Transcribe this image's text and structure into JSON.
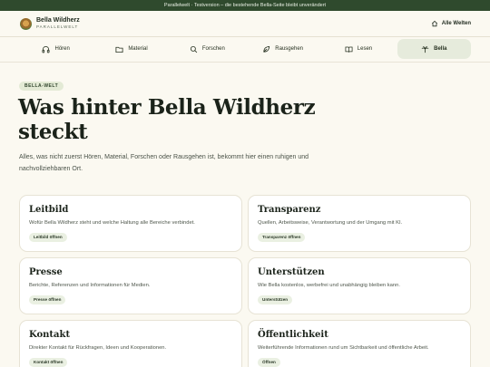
{
  "banner": {
    "text": "Parallelwelt · Testversion – die bestehende Bella-Seite bleibt unverändert"
  },
  "brand": {
    "name": "Bella Wildherz",
    "subtitle": "PARALLELWELT",
    "logo_icon": "bella-logo"
  },
  "header": {
    "worlds_label": "Alle Welten",
    "worlds_icon": "home-icon"
  },
  "nav": {
    "items": [
      {
        "label": "Hören",
        "icon": "headphones-icon",
        "active": false
      },
      {
        "label": "Material",
        "icon": "folder-icon",
        "active": false
      },
      {
        "label": "Forschen",
        "icon": "search-icon",
        "active": false
      },
      {
        "label": "Rausgehen",
        "icon": "leaf-icon",
        "active": false
      },
      {
        "label": "Lesen",
        "icon": "book-icon",
        "active": false
      },
      {
        "label": "Bella",
        "icon": "palm-icon",
        "active": true
      }
    ]
  },
  "main": {
    "badge": "BELLA-WELT",
    "title_line1": "Was hinter Bella Wildherz",
    "title_line2": "steckt",
    "lead": "Alles, was nicht zuerst Hören, Material, Forschen oder Rausgehen ist, bekommt hier einen ruhigen und nachvollziehbaren Ort."
  },
  "cards": [
    {
      "title": "Leitbild",
      "desc": "Wofür Bella Wildherz steht und welche Haltung alle Bereiche verbindet.",
      "button": "Leitbild öffnen"
    },
    {
      "title": "Transparenz",
      "desc": "Quellen, Arbeitsweise, Verantwortung und der Umgang mit KI.",
      "button": "Transparenz öffnen"
    },
    {
      "title": "Presse",
      "desc": "Berichte, Referenzen und Informationen für Medien.",
      "button": "Presse öffnen"
    },
    {
      "title": "Unterstützen",
      "desc": "Wie Bella kostenlos, werbefrei und unabhängig bleiben kann.",
      "button": "Unterstützen"
    },
    {
      "title": "Kontakt",
      "desc": "Direkter Kontakt für Rückfragen, Ideen und Kooperationen.",
      "button": "Kontakt öffnen"
    },
    {
      "title": "Öffentlichkeit",
      "desc": "Weiterführende Informationen rund um Sichtbarkeit und öffentliche Arbeit.",
      "button": "Öffnen"
    }
  ],
  "colors": {
    "banner": "#2f4a2d",
    "background": "#fbf9f1",
    "active_nav": "#e6ebdc",
    "pill": "#e3ead5"
  }
}
